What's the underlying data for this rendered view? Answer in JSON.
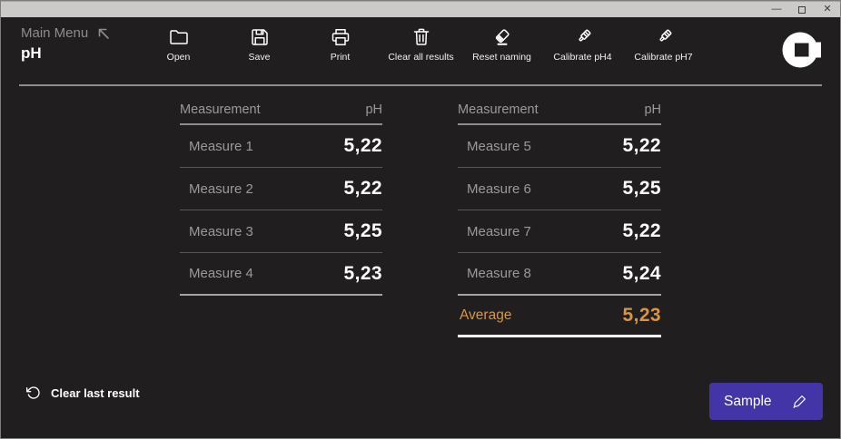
{
  "window": {
    "controls": {
      "minimize": "—",
      "close": "✕"
    }
  },
  "header": {
    "menu_label": "Main Menu",
    "title": "pH"
  },
  "toolbar": {
    "items": [
      {
        "icon": "folder-icon",
        "label": "Open"
      },
      {
        "icon": "save-icon",
        "label": "Save"
      },
      {
        "icon": "printer-icon",
        "label": "Print"
      },
      {
        "icon": "trash-icon",
        "label": "Clear all results"
      },
      {
        "icon": "eraser-icon",
        "label": "Reset naming"
      },
      {
        "icon": "probe-icon",
        "label": "Calibrate pH4"
      },
      {
        "icon": "probe-icon",
        "label": "Calibrate pH7"
      }
    ]
  },
  "tables": [
    {
      "headers": [
        "Measurement",
        "pH"
      ],
      "rows": [
        {
          "label": "Measure 1",
          "value": "5,22"
        },
        {
          "label": "Measure 2",
          "value": "5,22"
        },
        {
          "label": "Measure 3",
          "value": "5,25"
        },
        {
          "label": "Measure 4",
          "value": "5,23"
        }
      ]
    },
    {
      "headers": [
        "Measurement",
        "pH"
      ],
      "rows": [
        {
          "label": "Measure 5",
          "value": "5,22"
        },
        {
          "label": "Measure 6",
          "value": "5,25"
        },
        {
          "label": "Measure 7",
          "value": "5,22"
        },
        {
          "label": "Measure 8",
          "value": "5,24"
        }
      ],
      "average": {
        "label": "Average",
        "value": "5,23"
      }
    }
  ],
  "footer": {
    "clear_last_label": "Clear last result",
    "sample_label": "Sample"
  },
  "colors": {
    "accent_purple": "#4335a8",
    "average_orange": "#dd9440",
    "background": "#201e1e",
    "titlebar_gray": "#cbcac9"
  }
}
